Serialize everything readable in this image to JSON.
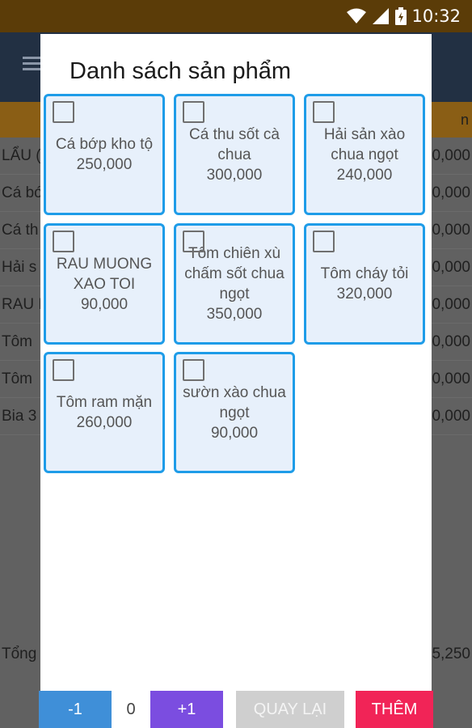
{
  "status_bar": {
    "time": "10:32",
    "icons": [
      "wifi-icon",
      "signal-icon",
      "battery-icon"
    ]
  },
  "background_list": {
    "header_right": "n",
    "rows": [
      {
        "left": "LẨU (",
        "right": "0,000"
      },
      {
        "left": "Cá bớ",
        "right": "0,000"
      },
      {
        "left": "Cá th",
        "right": "0,000"
      },
      {
        "left": "Hải s",
        "right": "0,000"
      },
      {
        "left": "RAU I",
        "right": "0,000"
      },
      {
        "left": "Tôm",
        "right": "0,000"
      },
      {
        "left": "Tôm",
        "right": "0,000"
      },
      {
        "left": "Bia 3",
        "right": "0,000"
      }
    ],
    "total_left": "Tổng",
    "total_right": "5,250"
  },
  "dialog": {
    "title": "Danh sách sản phẩm",
    "products": [
      {
        "name": "Cá bớp kho tộ",
        "price": "250,000",
        "checked": false
      },
      {
        "name": "Cá thu sốt cà chua",
        "price": "300,000",
        "checked": false
      },
      {
        "name": "Hải sản xào chua ngọt",
        "price": "240,000",
        "checked": false
      },
      {
        "name": "RAU MUONG XAO TOI",
        "price": "90,000",
        "checked": false
      },
      {
        "name": "Tôm chiên xù chấm sốt chua ngọt",
        "price": "350,000",
        "checked": false
      },
      {
        "name": "Tôm cháy tỏi",
        "price": "320,000",
        "checked": false
      },
      {
        "name": "Tôm ram mặn",
        "price": "260,000",
        "checked": false
      },
      {
        "name": "sườn xào chua ngọt",
        "price": "90,000",
        "checked": false
      }
    ],
    "buttons": {
      "minus": "-1",
      "quantity": "0",
      "plus": "+1",
      "back": "QUAY LẠI",
      "add": "THÊM"
    }
  },
  "colors": {
    "status_bar": "#5b3c08",
    "card_border": "#1e9ce8",
    "card_bg": "#e7f0fb",
    "minus_button": "#3f8fd8",
    "plus_button": "#7b4de0",
    "back_button": "#cfcfcf",
    "add_button": "#f12457"
  }
}
